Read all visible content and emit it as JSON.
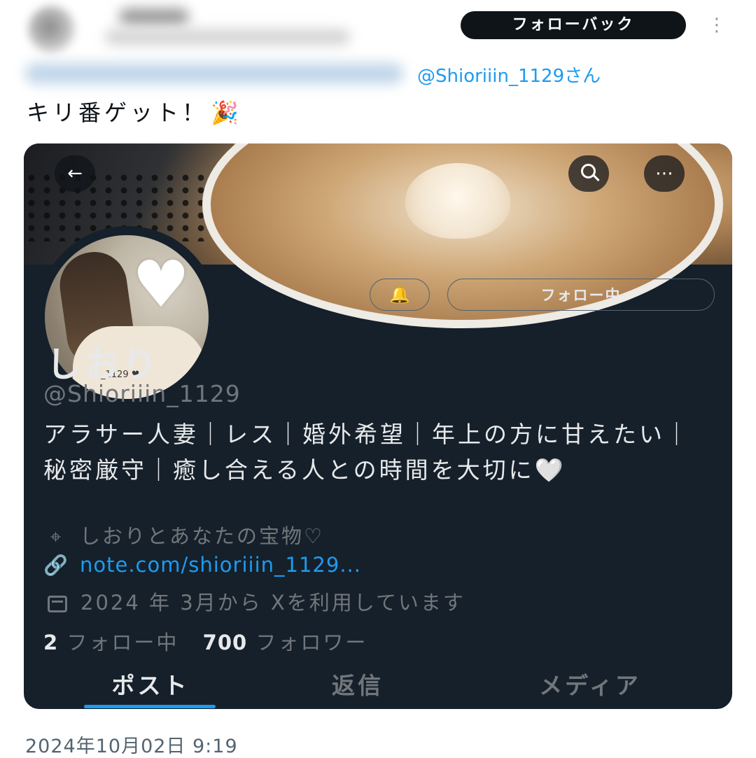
{
  "tweet": {
    "follow_back_label": "フォローバック",
    "more_glyph": "⋮",
    "reply_to_suffix": "@Shioriiin_1129さん",
    "text": "キリ番ゲット！",
    "emoji": "🎉",
    "timestamp": "2024年10月02日 9:19"
  },
  "profile_card": {
    "back_glyph": "←",
    "more_glyph": "⋯",
    "avatar_caption": "_1129 ♥",
    "avatar_heart": "♥",
    "notify_glyph": "🔔",
    "following_label": "フォロー中",
    "display_name": "しおり",
    "handle": "@Shioriiin_1129",
    "bio": "アラサー人妻｜レス｜婚外希望｜年上の方に甘えたい｜秘密厳守｜癒し合える人との時間を大切に🤍",
    "location_glyph": "⌖",
    "location": "しおりとあなたの宝物♡",
    "link_glyph": "🔗",
    "link": "note.com/shioriiin_1129...",
    "joined": "2024 年 3月から Xを利用しています",
    "following_count": "2",
    "following_label_small": "フォロー中",
    "followers_count": "700",
    "followers_label": "フォロワー",
    "tabs": [
      {
        "label": "ポスト"
      },
      {
        "label": "返信"
      },
      {
        "label": "メディア"
      }
    ]
  },
  "colors": {
    "card_background": "#15202b",
    "accent": "#1d9bf0",
    "muted_text": "#71767b"
  },
  "icons": [
    "kebab-menu-icon",
    "back-arrow-icon",
    "search-icon",
    "more-icon",
    "bell-plus-icon",
    "location-pin-icon",
    "link-icon",
    "calendar-icon",
    "party-popper-icon",
    "white-heart-icon"
  ]
}
